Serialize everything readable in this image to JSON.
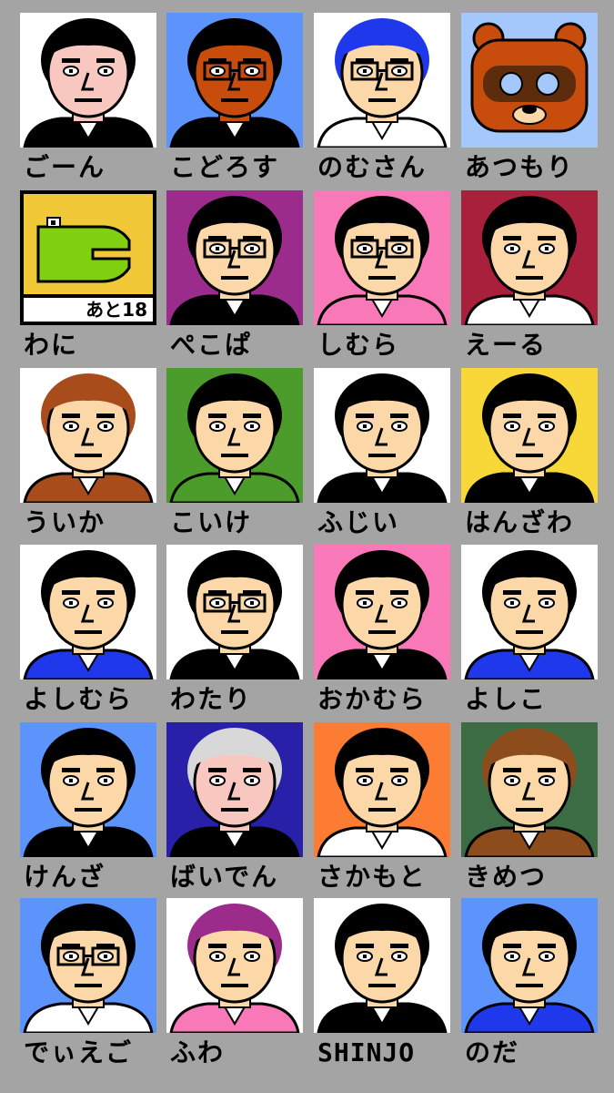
{
  "characters": [
    {
      "name": "ごーん",
      "bg": "#ffffff",
      "skin": "#f8c8c0",
      "hair": "#000000",
      "shirt": "#000000",
      "glasses": false,
      "animal": null
    },
    {
      "name": "こどろす",
      "bg": "#5c94fc",
      "skin": "#c84c0c",
      "hair": "#000000",
      "shirt": "#000000",
      "glasses": true,
      "animal": null
    },
    {
      "name": "のむさん",
      "bg": "#ffffff",
      "skin": "#fcd8a8",
      "hair": "#2038ec",
      "shirt": "#ffffff",
      "glasses": true,
      "animal": null
    },
    {
      "name": "あつもり",
      "bg": "#a4c8fc",
      "skin": "#c84c0c",
      "hair": "#000000",
      "shirt": "#c84c0c",
      "glasses": false,
      "animal": "tanuki"
    },
    {
      "name": "わに",
      "bg": "#fcfcfc",
      "skin": "#80d010",
      "hair": "#000000",
      "shirt": "#000000",
      "glasses": false,
      "animal": "croc",
      "badge": "あと18"
    },
    {
      "name": "ぺこぱ",
      "bg": "#9c2c8c",
      "skin": "#fcd8a8",
      "hair": "#000000",
      "shirt": "#000000",
      "glasses": true,
      "animal": null
    },
    {
      "name": "しむら",
      "bg": "#f878b8",
      "skin": "#fcd8a8",
      "hair": "#000000",
      "shirt": "#f878b8",
      "glasses": true,
      "animal": null
    },
    {
      "name": "えーる",
      "bg": "#a8203c",
      "skin": "#fcd8a8",
      "hair": "#000000",
      "shirt": "#ffffff",
      "glasses": false,
      "animal": null
    },
    {
      "name": "ういか",
      "bg": "#ffffff",
      "skin": "#fcd8a8",
      "hair": "#a84c1c",
      "shirt": "#a84c1c",
      "glasses": false,
      "animal": null
    },
    {
      "name": "こいけ",
      "bg": "#4c9c2c",
      "skin": "#fcd8a8",
      "hair": "#000000",
      "shirt": "#4c9c2c",
      "glasses": false,
      "animal": null
    },
    {
      "name": "ふじい",
      "bg": "#ffffff",
      "skin": "#fcd8a8",
      "hair": "#000000",
      "shirt": "#000000",
      "glasses": false,
      "animal": null
    },
    {
      "name": "はんざわ",
      "bg": "#f8d838",
      "skin": "#fcd8a8",
      "hair": "#000000",
      "shirt": "#000000",
      "glasses": false,
      "animal": null
    },
    {
      "name": "よしむら",
      "bg": "#ffffff",
      "skin": "#fcd8a8",
      "hair": "#000000",
      "shirt": "#2038ec",
      "glasses": false,
      "animal": null
    },
    {
      "name": "わたり",
      "bg": "#ffffff",
      "skin": "#fcd8a8",
      "hair": "#000000",
      "shirt": "#000000",
      "glasses": true,
      "animal": null
    },
    {
      "name": "おかむら",
      "bg": "#f878b8",
      "skin": "#fcd8a8",
      "hair": "#000000",
      "shirt": "#000000",
      "glasses": false,
      "animal": null
    },
    {
      "name": "よしこ",
      "bg": "#ffffff",
      "skin": "#fcd8a8",
      "hair": "#000000",
      "shirt": "#2038ec",
      "glasses": false,
      "animal": null
    },
    {
      "name": "けんざ",
      "bg": "#5c94fc",
      "skin": "#fcd8a8",
      "hair": "#000000",
      "shirt": "#000000",
      "glasses": false,
      "animal": null
    },
    {
      "name": "ばいでん",
      "bg": "#2820a8",
      "skin": "#f8c8c0",
      "hair": "#d8d8d8",
      "shirt": "#000000",
      "glasses": false,
      "animal": null
    },
    {
      "name": "さかもと",
      "bg": "#fc7c34",
      "skin": "#fcd8a8",
      "hair": "#000000",
      "shirt": "#ffffff",
      "glasses": false,
      "animal": null
    },
    {
      "name": "きめつ",
      "bg": "#3c6c44",
      "skin": "#fcd8a8",
      "hair": "#8c4c1c",
      "shirt": "#8c4c1c",
      "glasses": false,
      "animal": null
    },
    {
      "name": "でぃえご",
      "bg": "#5c94fc",
      "skin": "#fcd8a8",
      "hair": "#000000",
      "shirt": "#ffffff",
      "glasses": true,
      "animal": null
    },
    {
      "name": "ふわ",
      "bg": "#ffffff",
      "skin": "#fcd8a8",
      "hair": "#9c2c8c",
      "shirt": "#f878b8",
      "glasses": false,
      "animal": null
    },
    {
      "name": "SHINJO",
      "bg": "#ffffff",
      "skin": "#fcd8a8",
      "hair": "#000000",
      "shirt": "#000000",
      "glasses": false,
      "animal": null
    },
    {
      "name": "のだ",
      "bg": "#5c94fc",
      "skin": "#fcd8a8",
      "hair": "#000000",
      "shirt": "#2038ec",
      "glasses": false,
      "animal": null
    }
  ]
}
